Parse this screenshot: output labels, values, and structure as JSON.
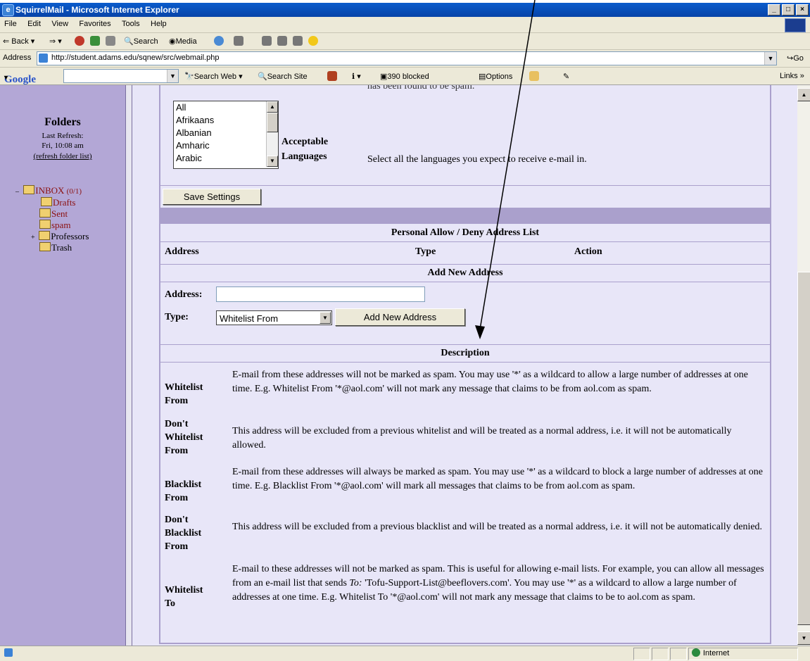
{
  "window": {
    "title": "SquirrelMail - Microsoft Internet Explorer"
  },
  "menu": [
    "File",
    "Edit",
    "View",
    "Favorites",
    "Tools",
    "Help"
  ],
  "toolbar": {
    "back": "Back",
    "search": "Search",
    "media": "Media"
  },
  "addressbar": {
    "label": "Address",
    "url": "http://student.adams.edu/sqnew/src/webmail.php",
    "go": "Go"
  },
  "googlebar": {
    "logo": "Google",
    "search_web": "Search Web",
    "search_site": "Search Site",
    "blocked": "390 blocked",
    "options": "Options",
    "links": "Links"
  },
  "sidebar": {
    "title": "Folders",
    "last_refresh_label": "Last Refresh:",
    "last_refresh_time": "Fri, 10:08 am",
    "refresh_link": "(refresh folder list)",
    "folders": {
      "inbox": "INBOX",
      "inbox_count": "(0/1)",
      "drafts": "Drafts",
      "sent": "Sent",
      "spam": "spam",
      "professors": "Professors",
      "trash": "Trash"
    }
  },
  "main": {
    "top_text": "has been found to be spam.",
    "languages": {
      "options": [
        "All",
        "Afrikaans",
        "Albanian",
        "Amharic",
        "Arabic"
      ],
      "label_line1": "Acceptable",
      "label_line2": "Languages",
      "help": "Select all the languages you expect to receive e-mail in."
    },
    "save_button": "Save Settings",
    "list_title": "Personal Allow / Deny Address List",
    "columns": {
      "address": "Address",
      "type": "Type",
      "action": "Action"
    },
    "add_title": "Add New Address",
    "form": {
      "address_label": "Address:",
      "address_value": "",
      "type_label": "Type:",
      "type_value": "Whitelist From",
      "add_button": "Add New Address"
    },
    "description_title": "Description",
    "descriptions": [
      {
        "term_lines": [
          "Whitelist",
          "From"
        ],
        "text": "E-mail from these addresses will not be marked as spam. You may use '*' as a wildcard to allow a large number of addresses at one time. E.g. Whitelist From '*@aol.com' will not mark any message that claims to be from aol.com as spam."
      },
      {
        "term_lines": [
          "Don't",
          "Whitelist",
          "From"
        ],
        "text": "This address will be excluded from a previous whitelist and will be treated as a normal address, i.e. it will not be automatically allowed."
      },
      {
        "term_lines": [
          "Blacklist",
          "From"
        ],
        "text": "E-mail from these addresses will always be marked as spam. You may use '*' as a wildcard to block a large number of addresses at one time. E.g. Blacklist From '*@aol.com' will mark all messages that claims to be from aol.com as spam."
      },
      {
        "term_lines": [
          "Don't",
          "Blacklist",
          "From"
        ],
        "text": "This address will be excluded from a previous blacklist and will be treated as a normal address, i.e. it will not be automatically denied."
      },
      {
        "term_lines": [
          "Whitelist",
          "To"
        ],
        "text_before": "E-mail to these addresses will not be marked as spam. This is useful for allowing e-mail lists. For example, you can allow all messages from an e-mail list that sends ",
        "text_em": "To:",
        "text_after": " 'Tofu-Support-List@beeflovers.com'. You may use '*' as a wildcard to allow a large number of addresses at one time. E.g. Whitelist To '*@aol.com' will not mark any message that claims to be to aol.com as spam."
      }
    ]
  },
  "status": {
    "zone": "Internet"
  },
  "colors": {
    "sidebar": "#b3a7d6",
    "content": "#e8e6f8",
    "border": "#aaa0cc",
    "title_bar": "#0743a8"
  }
}
